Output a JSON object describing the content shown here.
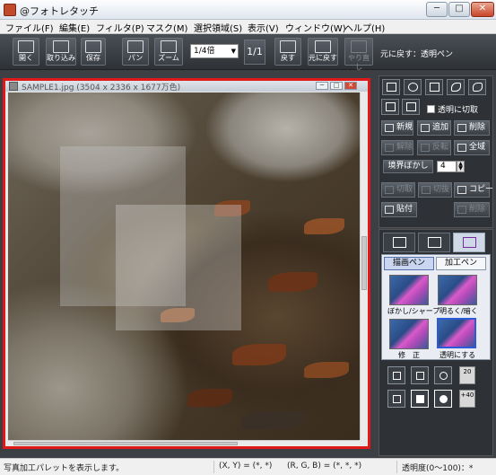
{
  "window": {
    "title": "@フォトレタッチ",
    "buttons": {
      "minimize": "─",
      "maximize": "□",
      "close": "✕"
    }
  },
  "menu": {
    "items": [
      "ファイル(F)",
      "編集(E)",
      "フィルタ(P)",
      "マスク(M)",
      "選択領域(S)",
      "表示(V)",
      "ウィンドウ(W)",
      "ヘルプ(H)"
    ]
  },
  "toolbar": {
    "open": "開く",
    "import": "取り込み",
    "save": "保存",
    "pan": "パン",
    "zoom": "ズーム",
    "zoom_value": "1/4倍",
    "ratio": "1/1",
    "back": "戻す",
    "undo": "元に戻す",
    "redo": "やり直し",
    "undo_label": "元に戻す：透明ペン"
  },
  "document": {
    "title": "SAMPLE1.jpg (3504 x 2336 x 1677万色)"
  },
  "tool_panel": {
    "transparent_cut": "透明に切取",
    "new": "新規",
    "add": "追加",
    "delete_sel": "削除",
    "cancel": "解除",
    "invert": "反転",
    "select_all": "全域",
    "edge_blur": "境界ぼかし",
    "edge_blur_value": "4",
    "cut": "切取",
    "crop": "切抜",
    "copy": "コピー",
    "paste": "貼付",
    "delete": "削除"
  },
  "pen_panel": {
    "tab_draw": "描画ペン",
    "tab_process": "加工ペン",
    "pens": [
      "ぼかし/シャープ",
      "明るく/暗く",
      "修　正",
      "透明にする"
    ],
    "selected_pen": "透明にする",
    "sizes": [
      "20",
      "+40"
    ]
  },
  "status": {
    "message": "写真加工パレットを表示します。",
    "xy": "(X, Y) = (*, *)",
    "rgb": "(R, G, B) = (*, *, *)",
    "opacity": "透明度(0〜100)：*"
  },
  "colors": {
    "highlight_border": "#e01818",
    "panel_bg": "#2e3236",
    "selected_pen_border": "#2d5bd8"
  }
}
